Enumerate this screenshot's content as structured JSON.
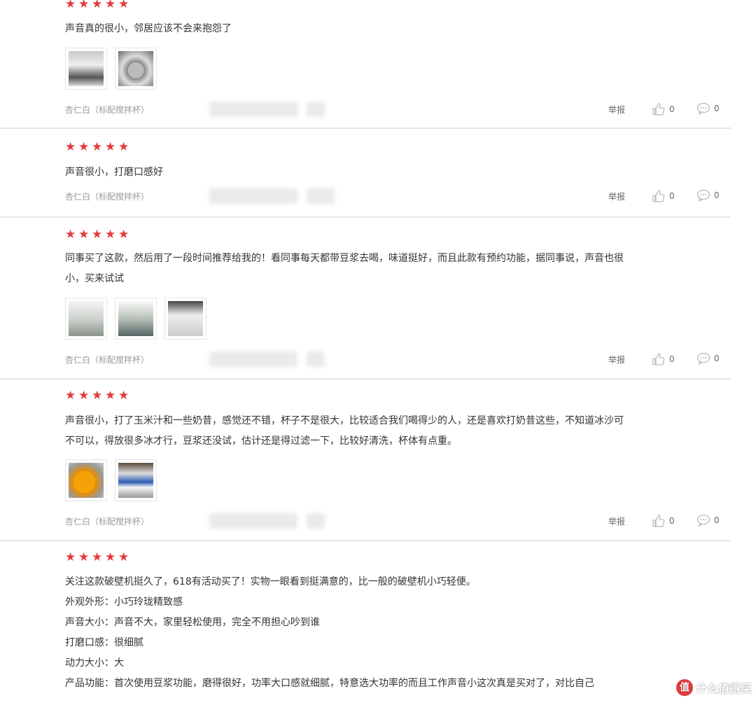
{
  "reviews": [
    {
      "rating": 5,
      "lines": [
        "声音真的很小，邻居应该不会来抱怨了"
      ],
      "photos": [
        "t1",
        "t2"
      ],
      "product": "杏仁白（标配搅拌杯）",
      "report": "举报",
      "likes": "0",
      "comments": "0"
    },
    {
      "rating": 5,
      "lines": [
        "声音很小，打磨口感好"
      ],
      "photos": [],
      "product": "杏仁白（标配搅拌杯）",
      "report": "举报",
      "likes": "0",
      "comments": "0"
    },
    {
      "rating": 5,
      "lines": [
        "同事买了这款，然后用了一段时间推荐给我的！看同事每天都带豆浆去喝，味道挺好，而且此款有预约功能，据同事说，声音也很",
        "小，买来试试"
      ],
      "photos": [
        "t3",
        "t4",
        "t5"
      ],
      "product": "杏仁白（标配搅拌杯）",
      "report": "举报",
      "likes": "0",
      "comments": "0"
    },
    {
      "rating": 5,
      "lines": [
        "声音很小，打了玉米汁和一些奶昔，感觉还不错，杯子不是很大，比较适合我们喝得少的人，还是喜欢打奶昔这些，不知道冰沙可",
        "不可以，得放很多冰才行，豆浆还没试，估计还是得过滤一下，比较好清洗，杯体有点重。"
      ],
      "photos": [
        "t6",
        "t7"
      ],
      "product": "杏仁白（标配搅拌杯）",
      "report": "举报",
      "likes": "0",
      "comments": "0"
    },
    {
      "rating": 5,
      "lines": [
        "关注这款破壁机挺久了，618有活动买了！实物一眼看到挺满意的，比一般的破壁机小巧轻便。",
        "外观外形：小巧玲珑精致感",
        "声音大小：声音不大，家里轻松使用，完全不用担心吵到谁",
        "打磨口感：很细腻",
        "动力大小：大",
        "产品功能：首次使用豆浆功能，磨得很好，功率大口感就细腻，特意选大功率的而且工作声音小这次真是买对了，对比自己"
      ],
      "photos": [],
      "product": "",
      "report": "",
      "likes": "",
      "comments": ""
    }
  ],
  "watermark": "值 什么值得买",
  "colors": {
    "star": "#e4393c",
    "divider": "#e6e6e6",
    "meta": "#999999"
  }
}
